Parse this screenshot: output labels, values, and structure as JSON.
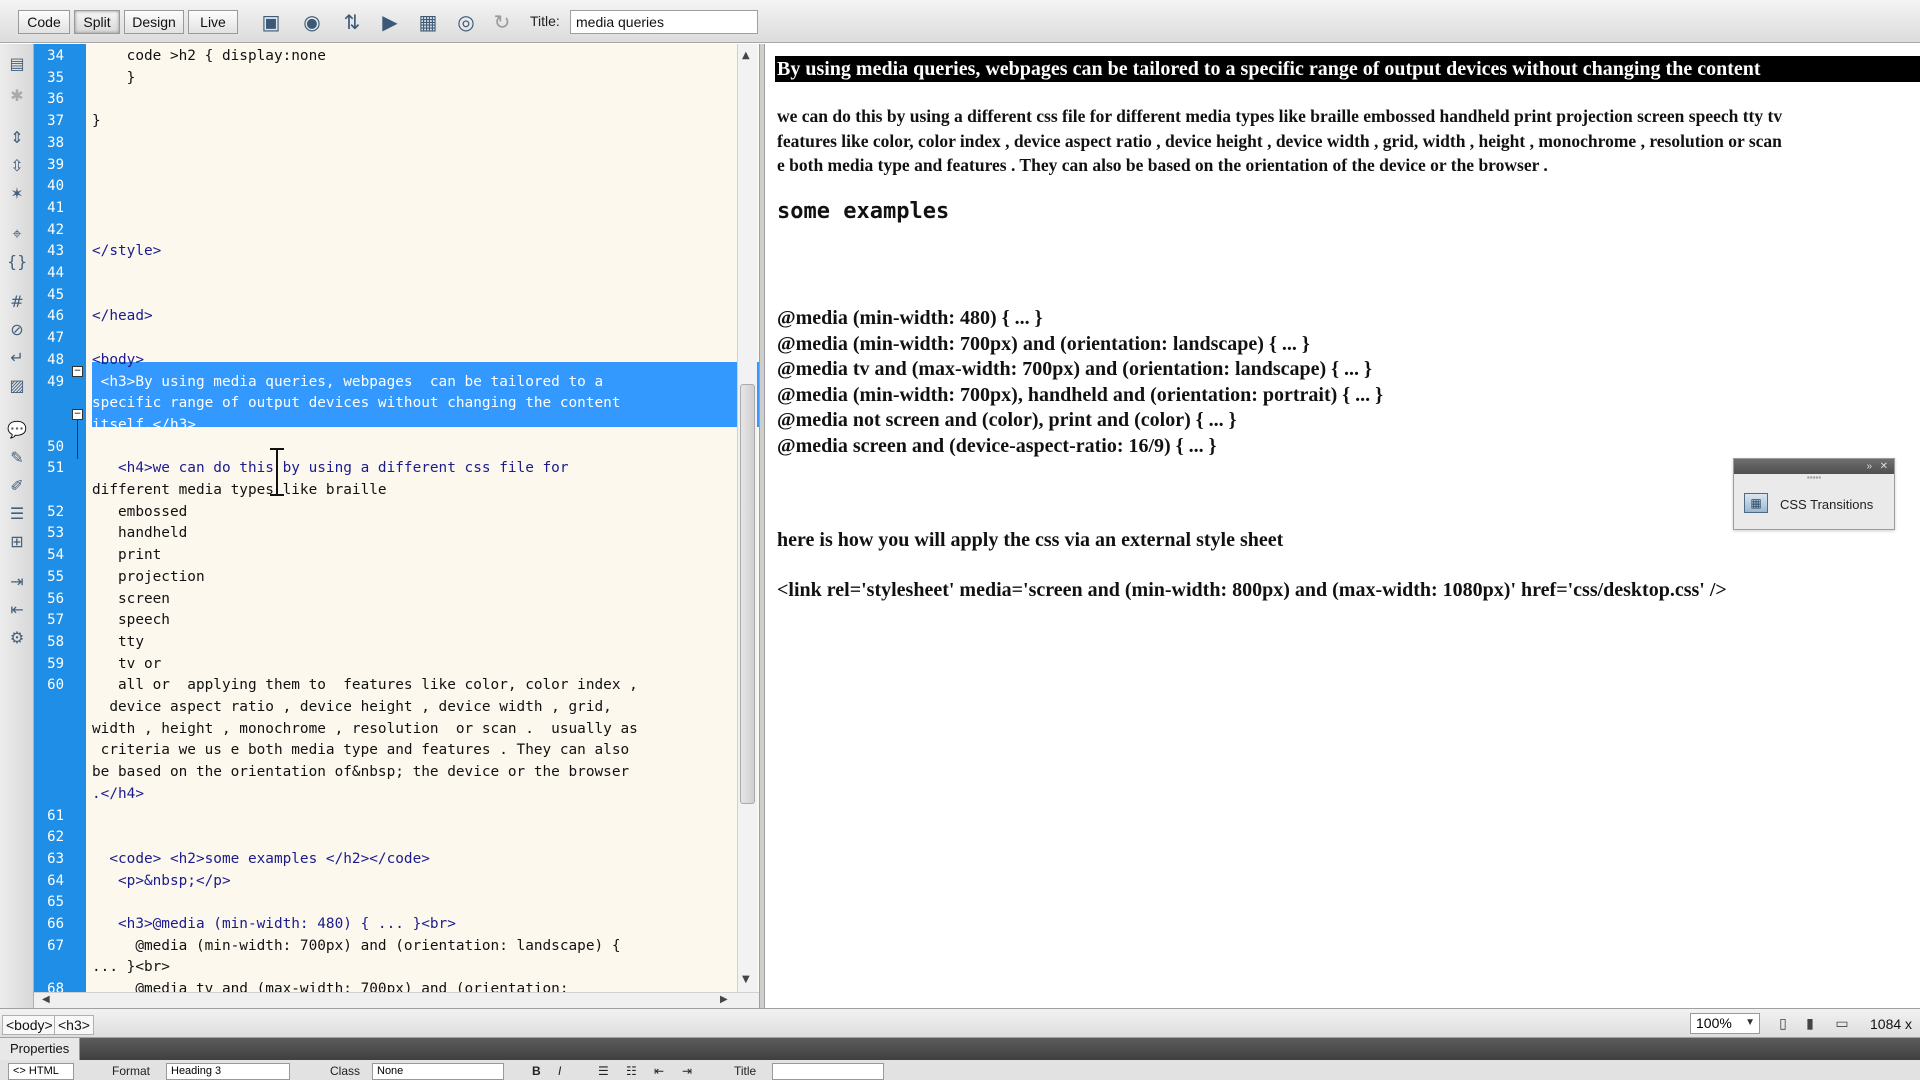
{
  "toolbar": {
    "views": [
      "Code",
      "Split",
      "Design",
      "Live"
    ],
    "active_view": "Split",
    "title_label": "Title:",
    "title_value": "media queries",
    "icons": [
      "multiscreen-icon",
      "preview-globe-icon",
      "file-management-icon",
      "live-view-options-icon",
      "visual-aids-icon",
      "check-browser-icon",
      "refresh-icon"
    ]
  },
  "code": {
    "line_numbers": [
      "34",
      "35",
      "36",
      "37",
      "38",
      "39",
      "40",
      "41",
      "42",
      "43",
      "44",
      "45",
      "46",
      "47",
      "48",
      "49",
      "50",
      "51",
      "52",
      "53",
      "54",
      "55",
      "56",
      "57",
      "58",
      "59",
      "60",
      "61",
      "62",
      "63",
      "64",
      "65",
      "66",
      "67",
      "68"
    ],
    "lines": [
      "    code >h2 { display:none",
      "    }",
      "",
      "}",
      "",
      "",
      "",
      "",
      "",
      "</style>",
      "",
      "",
      "</head>",
      "",
      "<body>",
      " <h3>By using media queries, webpages  can be tailored to a",
      "specific range of output devices without changing the content",
      "itself.</h3>",
      "",
      "   <h4>we can do this by using a different css file for",
      "different media types like braille",
      "   embossed",
      "   handheld",
      "   print",
      "   projection",
      "   screen",
      "   speech",
      "   tty",
      "   tv or",
      "   all or  applying them to  features like color, color index ,",
      "  device aspect ratio , device height , device width , grid,",
      "width , height , monochrome , resolution  or scan .  usually as",
      " criteria we us e both media type and features . They can also",
      "be based on the orientation of&nbsp; the device or the browser",
      ".</h4>",
      "",
      "",
      "  <code> <h2>some examples </h2></code>",
      "   <p>&nbsp;</p>",
      "",
      "   <h3>@media (min-width: 480) { ... }<br>",
      "     @media (min-width: 700px) and (orientation: landscape) {",
      "... }<br>",
      "     @media tv and (max-width: 700px) and (orientation:"
    ]
  },
  "preview": {
    "h3_selected": "By using media queries, webpages can be tailored to a specific range of output devices without changing the content",
    "h4_lines": [
      "we can do this by using a different css file for different media types like braille embossed handheld print projection screen speech tty tv",
      "features like color, color index , device aspect ratio , device height , device width , grid, width , height , monochrome , resolution or scan",
      "e both media type and features . They can also be based on the orientation of  the device or the browser ."
    ],
    "h2": "some examples",
    "media_lines": [
      "@media (min-width: 480) { ... }",
      "@media (min-width: 700px) and (orientation: landscape) { ... }",
      "@media tv and (max-width: 700px) and (orientation: landscape) { ... }",
      "@media (min-width: 700px), handheld and (orientation: portrait) { ... }",
      "@media not screen and (color), print and (color) { ... }",
      "@media screen and (device-aspect-ratio: 16/9) { ... }"
    ],
    "apply_heading": "here is how you will apply the css via an external style sheet",
    "link_example": "<link rel='stylesheet' media='screen and (min-width: 800px) and (max-width: 1080px)' href='css/desktop.css' />"
  },
  "panel": {
    "label": "CSS Transitions"
  },
  "status": {
    "tags": [
      "<body>",
      "<h3>"
    ],
    "zoom": "100%",
    "dimensions": "1084 x"
  },
  "properties": {
    "tab": "Properties",
    "html_label": "HTML",
    "format_label": "Format",
    "format_value": "Heading 3",
    "class_label": "Class",
    "class_value": "None",
    "title_label": "Title"
  }
}
